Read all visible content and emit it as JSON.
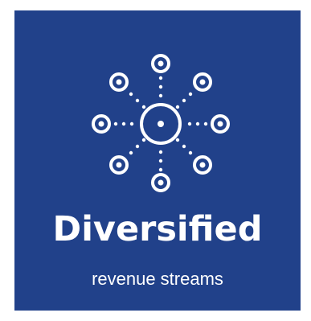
{
  "headline": "Diversified",
  "subheadline": "revenue streams",
  "icon": "network-hub-icon",
  "colors": {
    "background": "#21418a",
    "foreground": "#ffffff"
  }
}
